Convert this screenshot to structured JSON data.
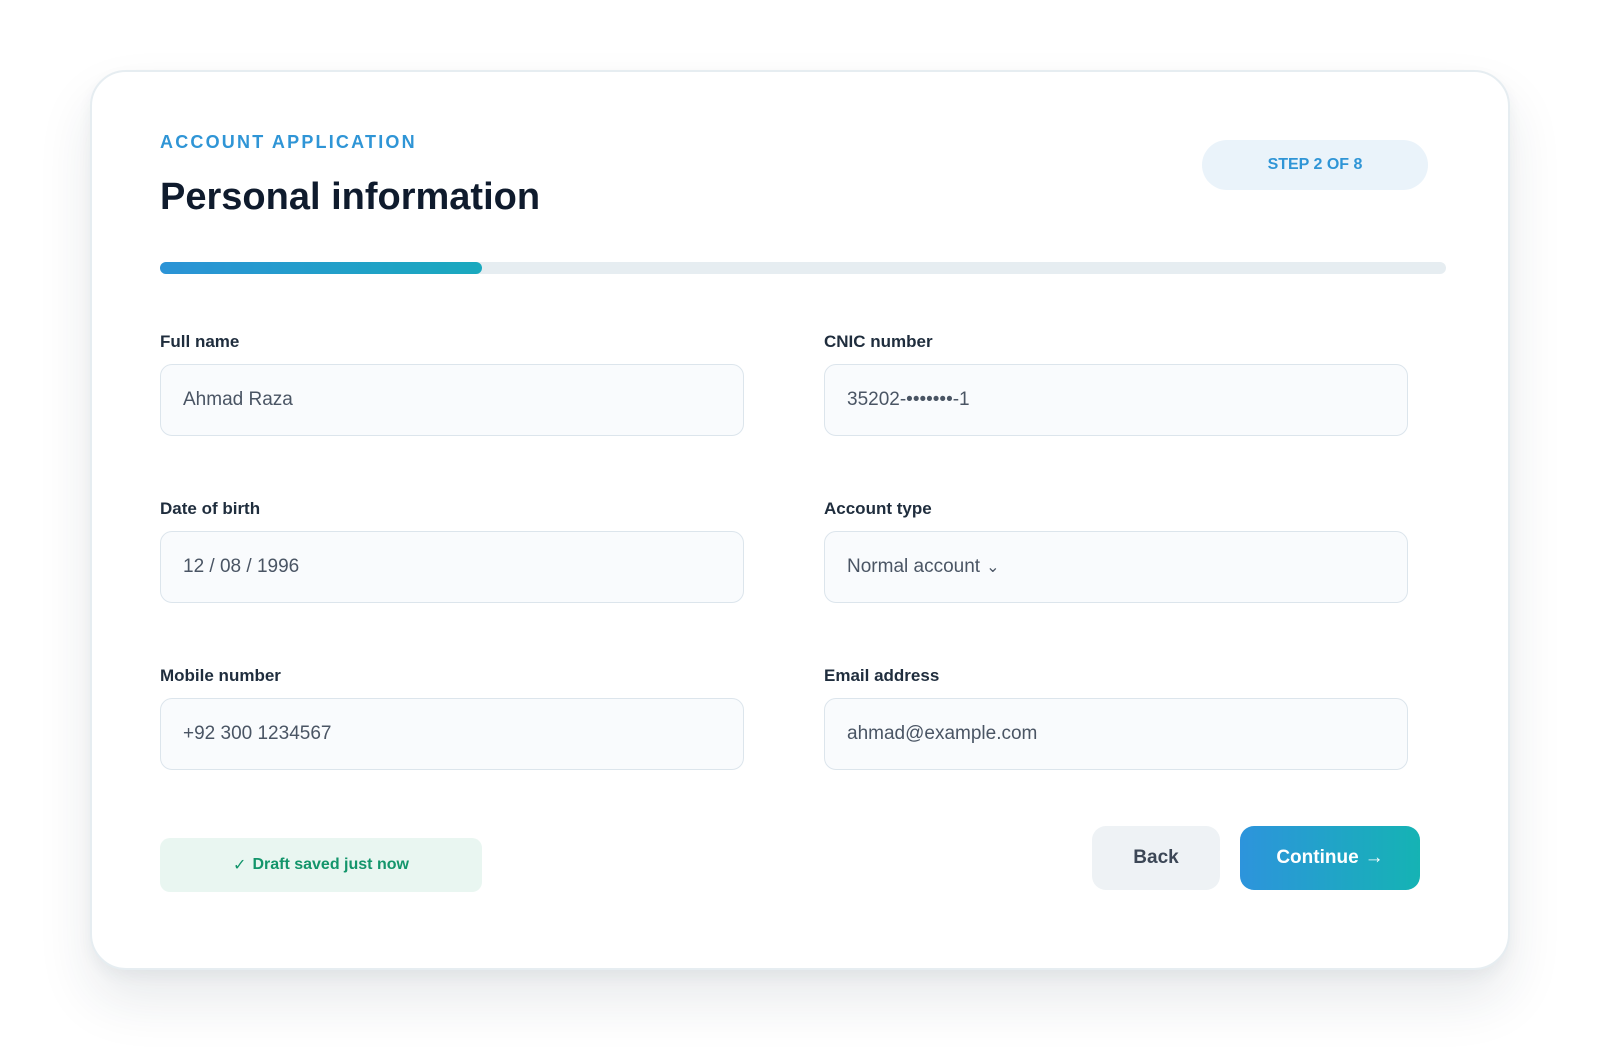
{
  "header": {
    "eyebrow": "ACCOUNT APPLICATION",
    "title": "Personal information",
    "step_label": "STEP 2 OF 8"
  },
  "progress": {
    "current_step": 2,
    "total_steps": 8,
    "fraction": 0.25
  },
  "form": {
    "full_name": {
      "label": "Full name",
      "value": "Ahmad Raza"
    },
    "cnic": {
      "label": "CNIC number",
      "value": "35202-•••••••-1"
    },
    "dob": {
      "label": "Date of birth",
      "value": "12 / 08 / 1996"
    },
    "account_type": {
      "label": "Account type",
      "value": "Normal account",
      "chevron": "⌄"
    },
    "mobile": {
      "label": "Mobile number",
      "value": "+92 300 1234567"
    },
    "email": {
      "label": "Email address",
      "value": "ahmad@example.com"
    }
  },
  "footer": {
    "draft_check": "✓",
    "draft_status": "Draft saved just now",
    "back_label": "Back",
    "continue_label": "Continue",
    "continue_arrow": "→"
  },
  "colors": {
    "accent": "#2f95d6",
    "gradient_end": "#15b3b4",
    "success": "#13956b",
    "title": "#0f1b2d"
  },
  "icons": {
    "chevron": "chevron-down-icon",
    "check": "check-icon",
    "arrow": "arrow-right-icon"
  }
}
